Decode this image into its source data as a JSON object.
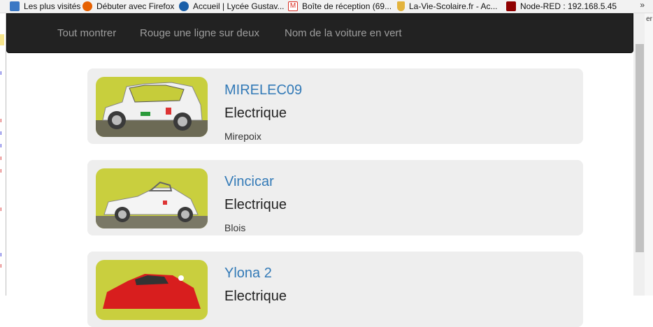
{
  "bookmarks": [
    {
      "label": "Les plus visités",
      "icon": "bookmark-folder-icon",
      "color": "#3b78c4"
    },
    {
      "label": "Débuter avec Firefox",
      "icon": "firefox-icon",
      "color": "#e66000"
    },
    {
      "label": "Accueil | Lycée Gustav...",
      "icon": "lycee-icon",
      "color": "#1a5fa8"
    },
    {
      "label": "Boîte de réception (69...",
      "icon": "gmail-icon",
      "color": "#d93025"
    },
    {
      "label": "La-Vie-Scolaire.fr - Ac...",
      "icon": "shield-icon",
      "color": "#e3b33d"
    },
    {
      "label": "Node-RED : 192.168.5.45",
      "icon": "node-red-icon",
      "color": "#8f0000"
    }
  ],
  "bookmarks_overflow": "»",
  "navbar": {
    "links": [
      "Tout montrer",
      "Rouge une ligne sur deux",
      "Nom de la voiture en vert"
    ]
  },
  "cars": [
    {
      "name": "MIRELEC09",
      "type": "Electrique",
      "city": "Mirepoix",
      "body_color": "#f1f1f1"
    },
    {
      "name": "Vincicar",
      "type": "Electrique",
      "city": "Blois",
      "body_color": "#f4f4f4"
    },
    {
      "name": "Ylona 2",
      "type": "Electrique",
      "city": "",
      "body_color": "#d81e1e"
    }
  ],
  "colors": {
    "navbar_bg": "#222222",
    "nav_link": "#9d9d9d",
    "card_bg": "#eeeeee",
    "link_blue": "#337ab7",
    "photo_bg": "#c9cf3e"
  }
}
